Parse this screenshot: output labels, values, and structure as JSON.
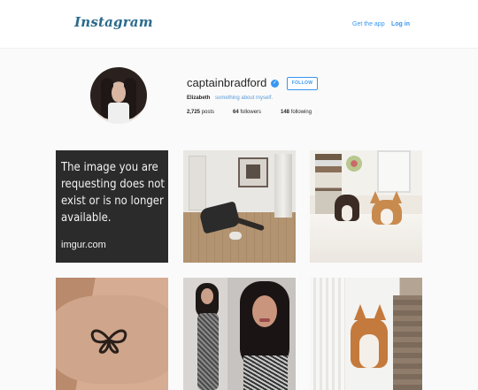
{
  "header": {
    "logo_text": "Instagram",
    "get_app_label": "Get the app",
    "login_label": "Log in"
  },
  "profile": {
    "username": "captainbradford",
    "verified_icon": "checkmark-badge-icon",
    "follow_label": "FOLLOW",
    "full_name": "Elizabeth",
    "bio": "something about myself.",
    "stats": {
      "posts_count": "2,725",
      "posts_label": "posts",
      "followers_count": "64",
      "followers_label": "followers",
      "following_count": "148",
      "following_label": "following"
    }
  },
  "posts": {
    "imgur_message": "The image you are requesting does not exist or is no longer available.",
    "imgur_brand": "imgur.com"
  },
  "colors": {
    "accent": "#3897f0",
    "logo": "#2b6a8c",
    "page_bg": "#fafafa"
  }
}
